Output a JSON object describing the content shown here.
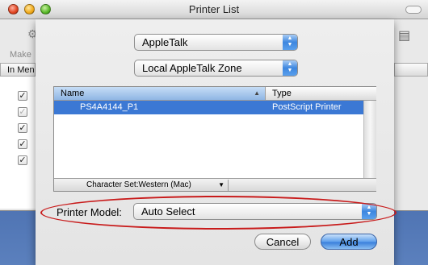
{
  "window": {
    "title": "Printer List",
    "toolbar_left_label": "Make",
    "column_header_left": "In Menu",
    "checkbox_states": [
      true,
      true,
      true,
      true,
      true
    ]
  },
  "sheet": {
    "connection_popup": "AppleTalk",
    "zone_popup": "Local AppleTalk Zone",
    "table": {
      "columns": [
        "Name",
        "Type"
      ],
      "rows": [
        {
          "name": "PS4A4144_P1",
          "type": "PostScript Printer",
          "selected": true
        }
      ]
    },
    "character_set": "Character Set:Western (Mac)",
    "printer_model_label": "Printer Model:",
    "printer_model_value": "Auto Select",
    "cancel_label": "Cancel",
    "add_label": "Add"
  },
  "colors": {
    "selection": "#3b78d4",
    "annotation": "#c81b1b",
    "default_button": "#3b80db"
  }
}
